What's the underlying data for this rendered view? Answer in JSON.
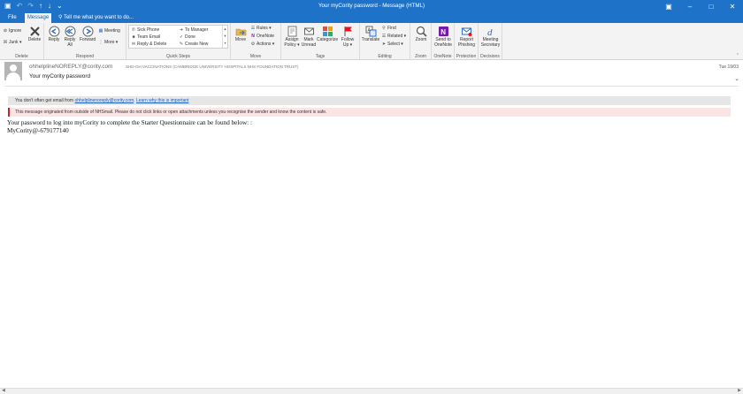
{
  "window": {
    "title": "Your myCority password - Message (HTML)",
    "controls": {
      "ribbon_display": "▣",
      "minimize": "–",
      "maximize": "□",
      "close": "✕"
    }
  },
  "qat": {
    "save": "▣",
    "undo": "↶",
    "redo": "↷",
    "up": "↑",
    "down": "↓",
    "more": "⌄"
  },
  "tabs": {
    "file": "File",
    "message": "Message",
    "tell_me": "Tell me what you want to do..."
  },
  "ribbon": {
    "delete_group": {
      "label": "Delete",
      "ignore": "Ignore",
      "junk": "Junk ▾",
      "delete": "Delete"
    },
    "respond_group": {
      "label": "Respond",
      "reply": "Reply",
      "reply_all": "Reply All",
      "forward": "Forward",
      "meeting": "Meeting",
      "more": "More ▾"
    },
    "quick_steps_group": {
      "label": "Quick Steps",
      "items": [
        "Sick Phone",
        "Team Email",
        "Reply & Delete",
        "To Manager",
        "Done",
        "Create New"
      ]
    },
    "move_group": {
      "label": "Move",
      "move": "Move",
      "rules": "Rules ▾",
      "onenote": "OneNote",
      "actions": "Actions ▾"
    },
    "tags_group": {
      "label": "Tags",
      "assign_policy": "Assign Policy ▾",
      "mark_unread": "Mark Unread",
      "categorize": "Categorize",
      "follow_up": "Follow Up ▾"
    },
    "editing_group": {
      "label": "Editing",
      "translate": "Translate",
      "find": "Find",
      "related": "Related ▾",
      "select": "Select ▾"
    },
    "zoom_group": {
      "label": "Zoom",
      "zoom": "Zoom"
    },
    "onenote_group": {
      "label": "OneNote",
      "send": "Send to OneNote"
    },
    "protection_group": {
      "label": "Protection",
      "report": "Report Phishing"
    },
    "decisions_group": {
      "label": "Decisions",
      "meeting_secretary": "Meeting Secretary"
    }
  },
  "message": {
    "sender": "ohhelplineNOREPLY@cority.com",
    "recipient": "SHD-OH.VACCINATIONS (CAMBRIDGE UNIVERSITY HOSPITALS NHS FOUNDATION TRUST)",
    "subject": "Your myCority password",
    "date": "Tue 19/03"
  },
  "info_bar": {
    "prefix": "You don't often get email from",
    "email": "ohhelplinenoreply@cority.com",
    "link": "Learn why this is important"
  },
  "warning_bar": "This message originated from outside of NHSmail. Please do not click links or open attachments unless you recognise the sender and know the content is safe.",
  "body": {
    "line1": "Your password to log into myCority to complete the Starter Questionnaire can be found below: :",
    "line2": "MyCority@-679177140"
  },
  "colors": {
    "accent": "#1e73c8",
    "warning": "#c62828",
    "onenote": "#7719aa",
    "flag": "#e81123"
  }
}
